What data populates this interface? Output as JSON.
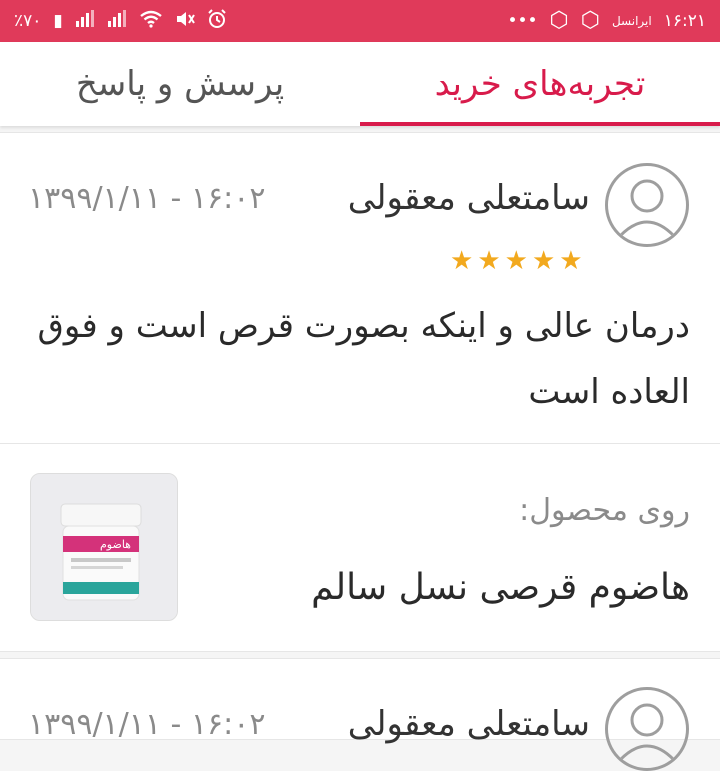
{
  "status_bar": {
    "battery": "٪۷۰",
    "time": "۱۶:۲۱",
    "carrier": "ایرانسل",
    "more": "•••",
    "icons": [
      "battery-icon",
      "signal-icon",
      "signal-icon",
      "wifi-icon",
      "mute-icon",
      "alarm-icon",
      "hexagon-icon",
      "hexagon-icon",
      "carrier-icon"
    ]
  },
  "tabs": [
    {
      "label": "تجربه‌های خرید",
      "active": true
    },
    {
      "label": "پرسش و پاسخ",
      "active": false
    }
  ],
  "review": {
    "author": "سامتعلی معقولی",
    "date": "۱۳۹۹/۱/۱۱ - ۱۶:۰۲",
    "rating": 5,
    "rating_max": 5,
    "text": "درمان عالی و اینکه بصورت قرص است و فوق العاده است"
  },
  "product": {
    "label": "روی محصول:",
    "name": "هاضوم قرصی نسل سالم",
    "jar_brand": "هاضوم"
  },
  "next_review": {
    "author": "سامتعلی معقولی",
    "date": "۱۳۹۹/۱/۱۱ - ۱۶:۰۲"
  },
  "colors": {
    "accent": "#d81b4b",
    "status_bar": "#e03a5a",
    "star": "#f2a91e",
    "text_muted": "#8a8a8a"
  }
}
